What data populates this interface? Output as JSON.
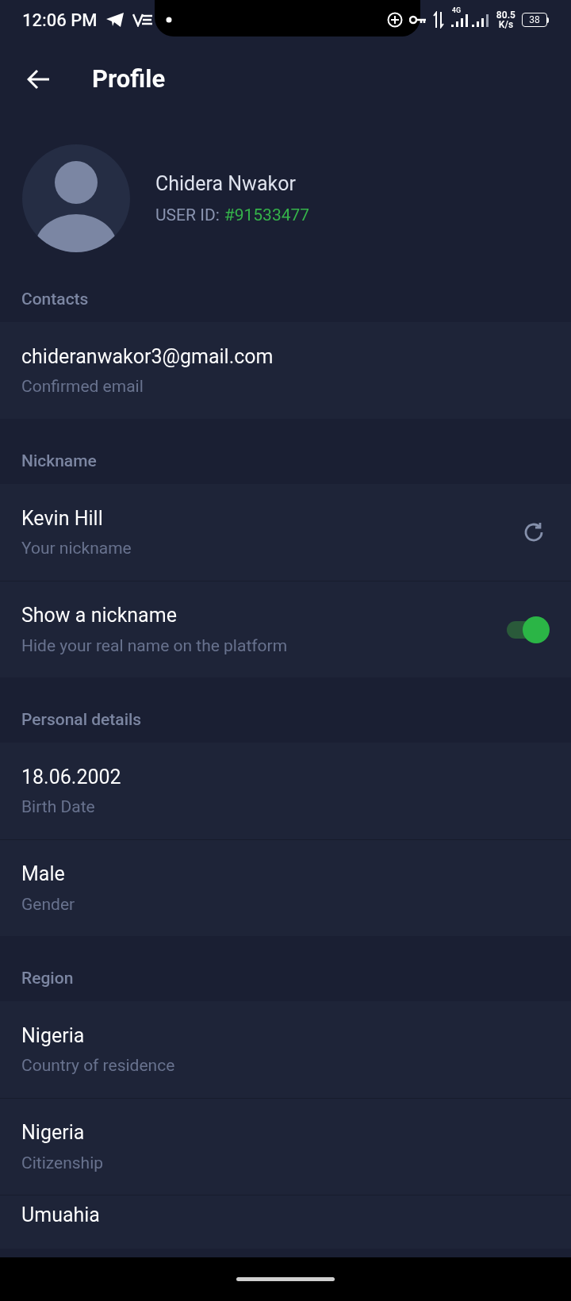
{
  "status_bar": {
    "time": "12:06 PM",
    "network_type": "4G",
    "speed_value": "80.5",
    "speed_unit": "K/s",
    "battery": "38"
  },
  "header": {
    "title": "Profile"
  },
  "profile": {
    "name": "Chidera Nwakor",
    "id_label": "USER ID:",
    "id_value": "#91533477"
  },
  "sections": [
    {
      "title": "Contacts",
      "rows": [
        {
          "kind": "text",
          "value": "chideranwakor3@gmail.com",
          "caption": "Confirmed email"
        }
      ]
    },
    {
      "title": "Nickname",
      "rows": [
        {
          "kind": "refresh",
          "value": "Kevin Hill",
          "caption": "Your nickname"
        },
        {
          "kind": "toggle",
          "value": "Show a nickname",
          "caption": "Hide your real name on the platform",
          "on": true
        }
      ]
    },
    {
      "title": "Personal details",
      "rows": [
        {
          "kind": "text",
          "value": "18.06.2002",
          "caption": "Birth Date"
        },
        {
          "kind": "text",
          "value": "Male",
          "caption": "Gender"
        }
      ]
    },
    {
      "title": "Region",
      "rows": [
        {
          "kind": "text",
          "value": "Nigeria",
          "caption": "Country of residence"
        },
        {
          "kind": "text",
          "value": "Nigeria",
          "caption": "Citizenship"
        },
        {
          "kind": "partial",
          "value": "Umuahia"
        }
      ]
    }
  ]
}
